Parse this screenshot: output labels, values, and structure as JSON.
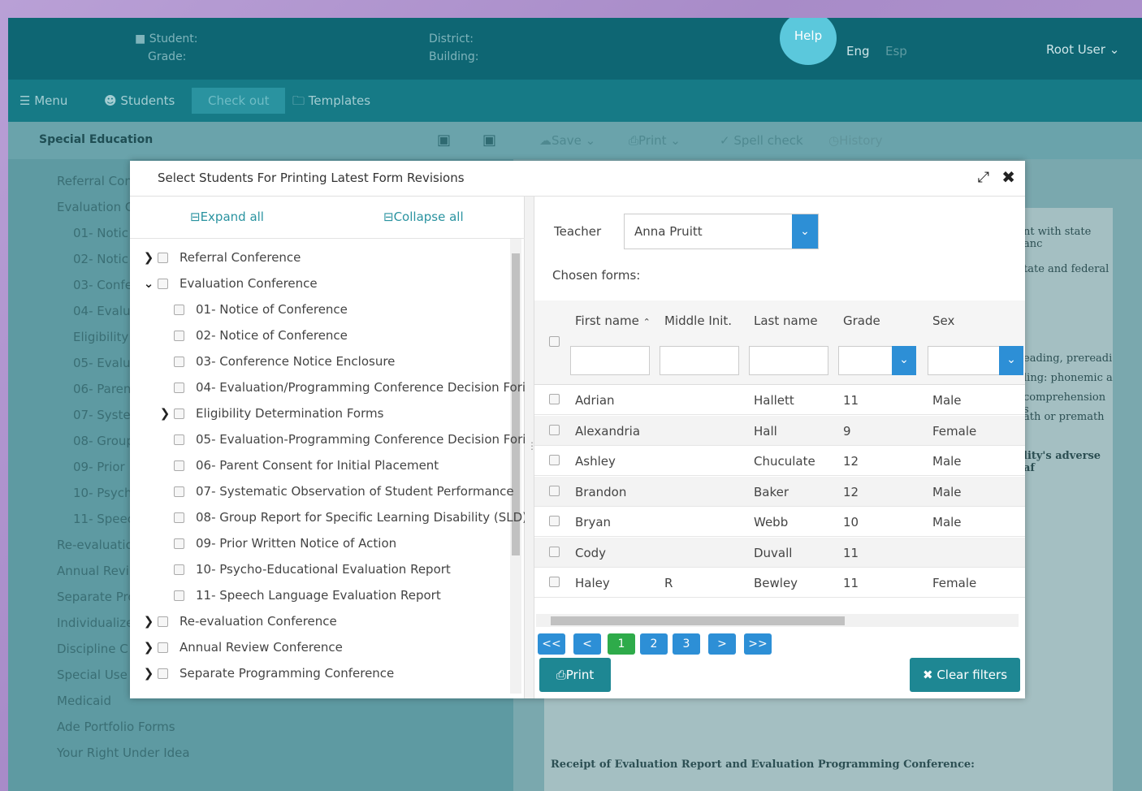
{
  "header": {
    "student_label": "Student:",
    "grade_label": "Grade:",
    "district_label": "District:",
    "building_label": "Building:",
    "help_label": "Help",
    "lang_eng": "Eng",
    "lang_esp": "Esp",
    "user_label": "Root User"
  },
  "nav": {
    "menu": "Menu",
    "students": "Students",
    "checkout": "Check out",
    "templates": "Templates"
  },
  "left_panel": {
    "title": "Special Education",
    "items": [
      "Referral Con",
      "Evaluation C",
      "01- Notic",
      "02- Notic",
      "03- Confe",
      "04- Evalu",
      "Eligibility",
      "05- Evalu",
      "06- Paren",
      "07- Syster",
      "08- Group",
      "09- Prior",
      "10- Psych",
      "11- Speec",
      "Re-evaluatio",
      "Annual Revi",
      "Separate Pro",
      "Individualize",
      "Discipline C",
      "Special Use I",
      "Medicaid",
      "Ade Portfolio Forms",
      "Your Right Under Idea"
    ]
  },
  "right_toolbar": {
    "save": "Save",
    "print": "Print",
    "spell": "Spell check",
    "history": "History"
  },
  "doc_snippets": {
    "s1": "nt with state anc",
    "s2": "tate and federal",
    "s3": "eading, prereadi",
    "s4": "ling: phonemic a",
    "s5": "comprehension s",
    "s6": "ath or premath",
    "s7": "lity's adverse af",
    "receipt": "Receipt of Evaluation Report and Evaluation Programming Conference:"
  },
  "modal": {
    "title": "Select Students For Printing Latest Form Revisions",
    "expand_all": "Expand all",
    "collapse_all": "Collapse all",
    "tree": [
      {
        "label": "Referral Conference",
        "level": 0,
        "chev": ">"
      },
      {
        "label": "Evaluation Conference",
        "level": 0,
        "chev": "v"
      },
      {
        "label": "01- Notice of Conference",
        "level": 1,
        "chev": ""
      },
      {
        "label": "02- Notice of Conference",
        "level": 1,
        "chev": ""
      },
      {
        "label": "03- Conference Notice Enclosure",
        "level": 1,
        "chev": ""
      },
      {
        "label": "04- Evaluation/Programming Conference Decision Fori",
        "level": 1,
        "chev": ""
      },
      {
        "label": "Eligibility Determination Forms",
        "level": 1,
        "chev": ">"
      },
      {
        "label": "05- Evaluation-Programming Conference Decision Fori",
        "level": 1,
        "chev": ""
      },
      {
        "label": "06- Parent Consent for Initial Placement",
        "level": 1,
        "chev": ""
      },
      {
        "label": "07- Systematic Observation of Student Performance",
        "level": 1,
        "chev": ""
      },
      {
        "label": "08- Group Report for Specific Learning Disability (SLD)",
        "level": 1,
        "chev": ""
      },
      {
        "label": "09- Prior Written Notice of Action",
        "level": 1,
        "chev": ""
      },
      {
        "label": "10- Psycho-Educational Evaluation Report",
        "level": 1,
        "chev": ""
      },
      {
        "label": "11- Speech Language Evaluation Report",
        "level": 1,
        "chev": ""
      },
      {
        "label": "Re-evaluation Conference",
        "level": 0,
        "chev": ">"
      },
      {
        "label": "Annual Review Conference",
        "level": 0,
        "chev": ">"
      },
      {
        "label": "Separate Programming Conference",
        "level": 0,
        "chev": ">"
      }
    ],
    "teacher_label": "Teacher",
    "teacher_value": "Anna Pruitt",
    "chosen_forms": "Chosen forms:",
    "columns": [
      "First name",
      "Middle Init.",
      "Last name",
      "Grade",
      "Sex"
    ],
    "rows": [
      {
        "first": "Adrian",
        "middle": "",
        "last": "Hallett",
        "grade": "11",
        "sex": "Male"
      },
      {
        "first": "Alexandria",
        "middle": "",
        "last": "Hall",
        "grade": "9",
        "sex": "Female"
      },
      {
        "first": "Ashley",
        "middle": "",
        "last": "Chuculate",
        "grade": "12",
        "sex": "Male"
      },
      {
        "first": "Brandon",
        "middle": "",
        "last": "Baker",
        "grade": "12",
        "sex": "Male"
      },
      {
        "first": "Bryan",
        "middle": "",
        "last": "Webb",
        "grade": "10",
        "sex": "Male"
      },
      {
        "first": "Cody",
        "middle": "",
        "last": "Duvall",
        "grade": "11",
        "sex": ""
      },
      {
        "first": "Haley",
        "middle": "R",
        "last": "Bewley",
        "grade": "11",
        "sex": "Female"
      }
    ],
    "pager": [
      "<<",
      "<",
      "1",
      "2",
      "3",
      ">",
      ">>"
    ],
    "print_btn": "Print",
    "clear_btn": "Clear filters"
  },
  "colors": {
    "header": "#0e6673",
    "accent": "#2d8fd6",
    "teal_btn": "#1e8793",
    "active_page": "#2eab4a"
  }
}
